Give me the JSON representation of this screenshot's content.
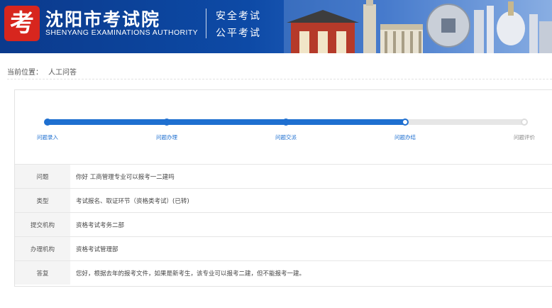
{
  "header": {
    "logo_char": "考",
    "title": "沈阳市考试院",
    "subtitle": "SHENYANG EXAMINATIONS AUTHORITY",
    "slogan_1": "安全考试",
    "slogan_2": "公平考试"
  },
  "breadcrumb": {
    "label": "当前位置：",
    "current": "人工问答"
  },
  "progress": {
    "steps": [
      {
        "label": "问题录入",
        "state": "done"
      },
      {
        "label": "问题办理",
        "state": "done"
      },
      {
        "label": "问题交派",
        "state": "done"
      },
      {
        "label": "问题办结",
        "state": "current"
      },
      {
        "label": "问题评价",
        "state": "pending"
      }
    ],
    "completed_fraction": 0.75
  },
  "details": [
    {
      "key": "问题",
      "value": "你好 工商管理专业可以报考一二建吗"
    },
    {
      "key": "类型",
      "value": "考试报名、取证环节（资格类考试）(已转)"
    },
    {
      "key": "提交机构",
      "value": "资格考试考务二部"
    },
    {
      "key": "办理机构",
      "value": "资格考试管理部"
    },
    {
      "key": "答复",
      "value": "您好，根据去年的报考文件，如果是新考生，该专业可以报考二建，但不能报考一建。"
    }
  ],
  "colors": {
    "banner": "#0d4aa6",
    "accent": "#1e6fd0",
    "logo": "#d7261e"
  }
}
